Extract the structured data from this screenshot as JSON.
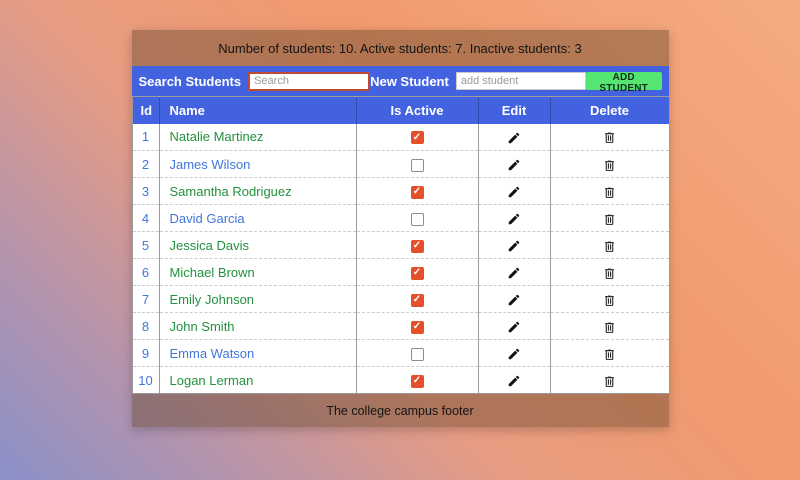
{
  "stats": {
    "text": "Number of students: 10. Active students: 7. Inactive students: 3"
  },
  "toolbar": {
    "search_label": "Search Students",
    "search_placeholder": "Search",
    "search_value": "",
    "new_student_label": "New Student",
    "new_student_placeholder": "add student",
    "new_student_value": "",
    "add_button_label": "ADD STUDENT"
  },
  "table": {
    "columns": [
      "Id",
      "Name",
      "Is Active",
      "Edit",
      "Delete"
    ],
    "rows": [
      {
        "id": "1",
        "name": "Natalie Martinez",
        "active": true
      },
      {
        "id": "2",
        "name": "James Wilson",
        "active": false
      },
      {
        "id": "3",
        "name": "Samantha Rodriguez",
        "active": true
      },
      {
        "id": "4",
        "name": "David Garcia",
        "active": false
      },
      {
        "id": "5",
        "name": "Jessica Davis",
        "active": true
      },
      {
        "id": "6",
        "name": "Michael Brown",
        "active": true
      },
      {
        "id": "7",
        "name": "Emily Johnson",
        "active": true
      },
      {
        "id": "8",
        "name": "John Smith",
        "active": true
      },
      {
        "id": "9",
        "name": "Emma Watson",
        "active": false
      },
      {
        "id": "10",
        "name": "Logan Lerman",
        "active": true
      }
    ]
  },
  "footer": {
    "text": "The college campus footer"
  },
  "icons": {
    "edit": "pencil-icon",
    "delete": "trash-icon",
    "checked": "checkmark-icon"
  },
  "colors": {
    "accent-blue": "#4262e0",
    "checkbox-red": "#e4502a",
    "button-green": "#55e571",
    "active-name": "#23913f",
    "inactive-name": "#4176dd",
    "search-border": "#bf4a36"
  }
}
